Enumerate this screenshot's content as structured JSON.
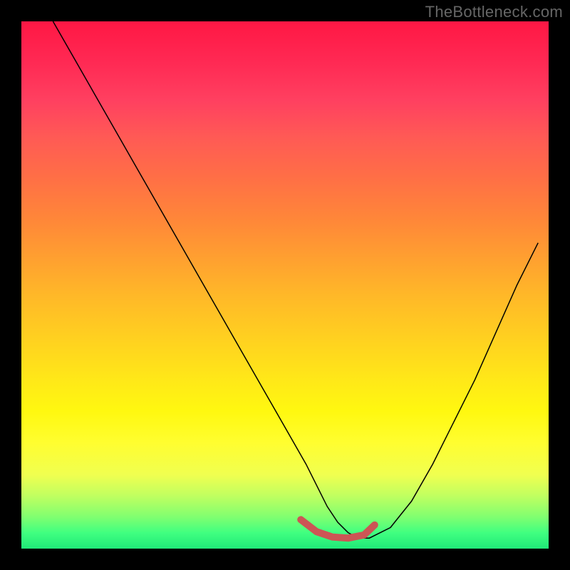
{
  "watermark": "TheBottleneck.com",
  "chart_data": {
    "type": "line",
    "title": "",
    "xlabel": "",
    "ylabel": "",
    "xlim": [
      0,
      100
    ],
    "ylim": [
      0,
      100
    ],
    "series": [
      {
        "name": "bottleneck-curve",
        "x": [
          6,
          10,
          14,
          18,
          22,
          26,
          30,
          34,
          38,
          42,
          46,
          50,
          54,
          56,
          58,
          60,
          62,
          64,
          66,
          70,
          74,
          78,
          82,
          86,
          90,
          94,
          98
        ],
        "values": [
          100,
          93,
          86,
          79,
          72,
          65,
          58,
          51,
          44,
          37,
          30,
          23,
          16,
          12,
          8,
          5,
          3,
          2,
          2,
          4,
          9,
          16,
          24,
          32,
          41,
          50,
          58
        ]
      }
    ],
    "highlight_region": {
      "name": "optimal-range",
      "x": [
        53,
        56,
        59,
        62,
        65,
        67
      ],
      "values": [
        5.5,
        3.2,
        2.2,
        2.0,
        2.6,
        4.5
      ]
    },
    "colors": {
      "gradient_top": "#ff1744",
      "gradient_mid": "#ffd020",
      "gradient_bottom": "#20e878",
      "curve": "#000000",
      "highlight": "#cc5555",
      "frame": "#000000"
    }
  }
}
